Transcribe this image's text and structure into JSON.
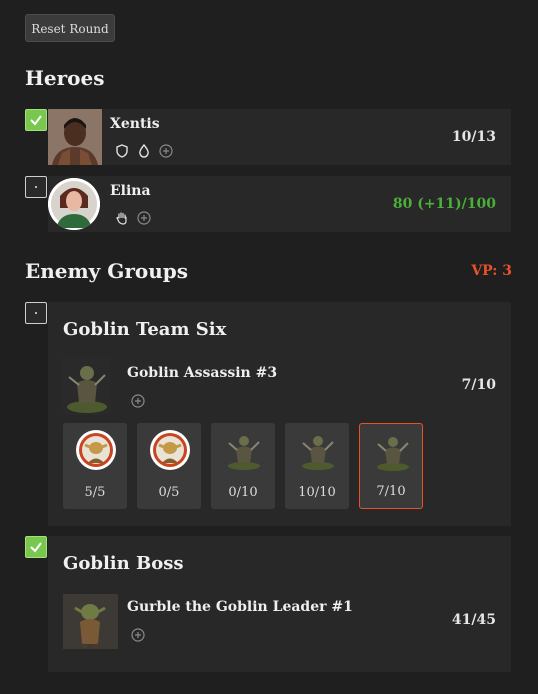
{
  "toolbar": {
    "reset_label": "Reset Round"
  },
  "heroes": {
    "heading": "Heroes",
    "items": [
      {
        "name": "Xentis",
        "hp": "10/13",
        "checked": true,
        "icons": [
          "shield-icon",
          "drop-icon",
          "plus-circle-icon"
        ]
      },
      {
        "name": "Elina",
        "hp": "80 (+11)/100",
        "checked": false,
        "icons": [
          "hand-icon",
          "plus-circle-icon"
        ]
      }
    ]
  },
  "enemies": {
    "heading": "Enemy Groups",
    "vp": "VP: 3",
    "groups": [
      {
        "title": "Goblin Team Six",
        "checked": false,
        "active": {
          "name": "Goblin Assassin #3",
          "hp": "7/10"
        },
        "members": [
          {
            "value": "5/5",
            "kind": "goblin-token"
          },
          {
            "value": "0/5",
            "kind": "goblin-token"
          },
          {
            "value": "0/10",
            "kind": "assassin"
          },
          {
            "value": "10/10",
            "kind": "assassin"
          },
          {
            "value": "7/10",
            "kind": "assassin",
            "selected": true
          }
        ]
      },
      {
        "title": "Goblin Boss",
        "checked": true,
        "active": {
          "name": "Gurble the Goblin Leader #1",
          "hp": "41/45"
        }
      }
    ]
  },
  "colors": {
    "accent": "#e8512a",
    "check": "#7ac74f",
    "healthy": "#4caf3a",
    "background": "#1f1f1f",
    "card": "#282828"
  }
}
